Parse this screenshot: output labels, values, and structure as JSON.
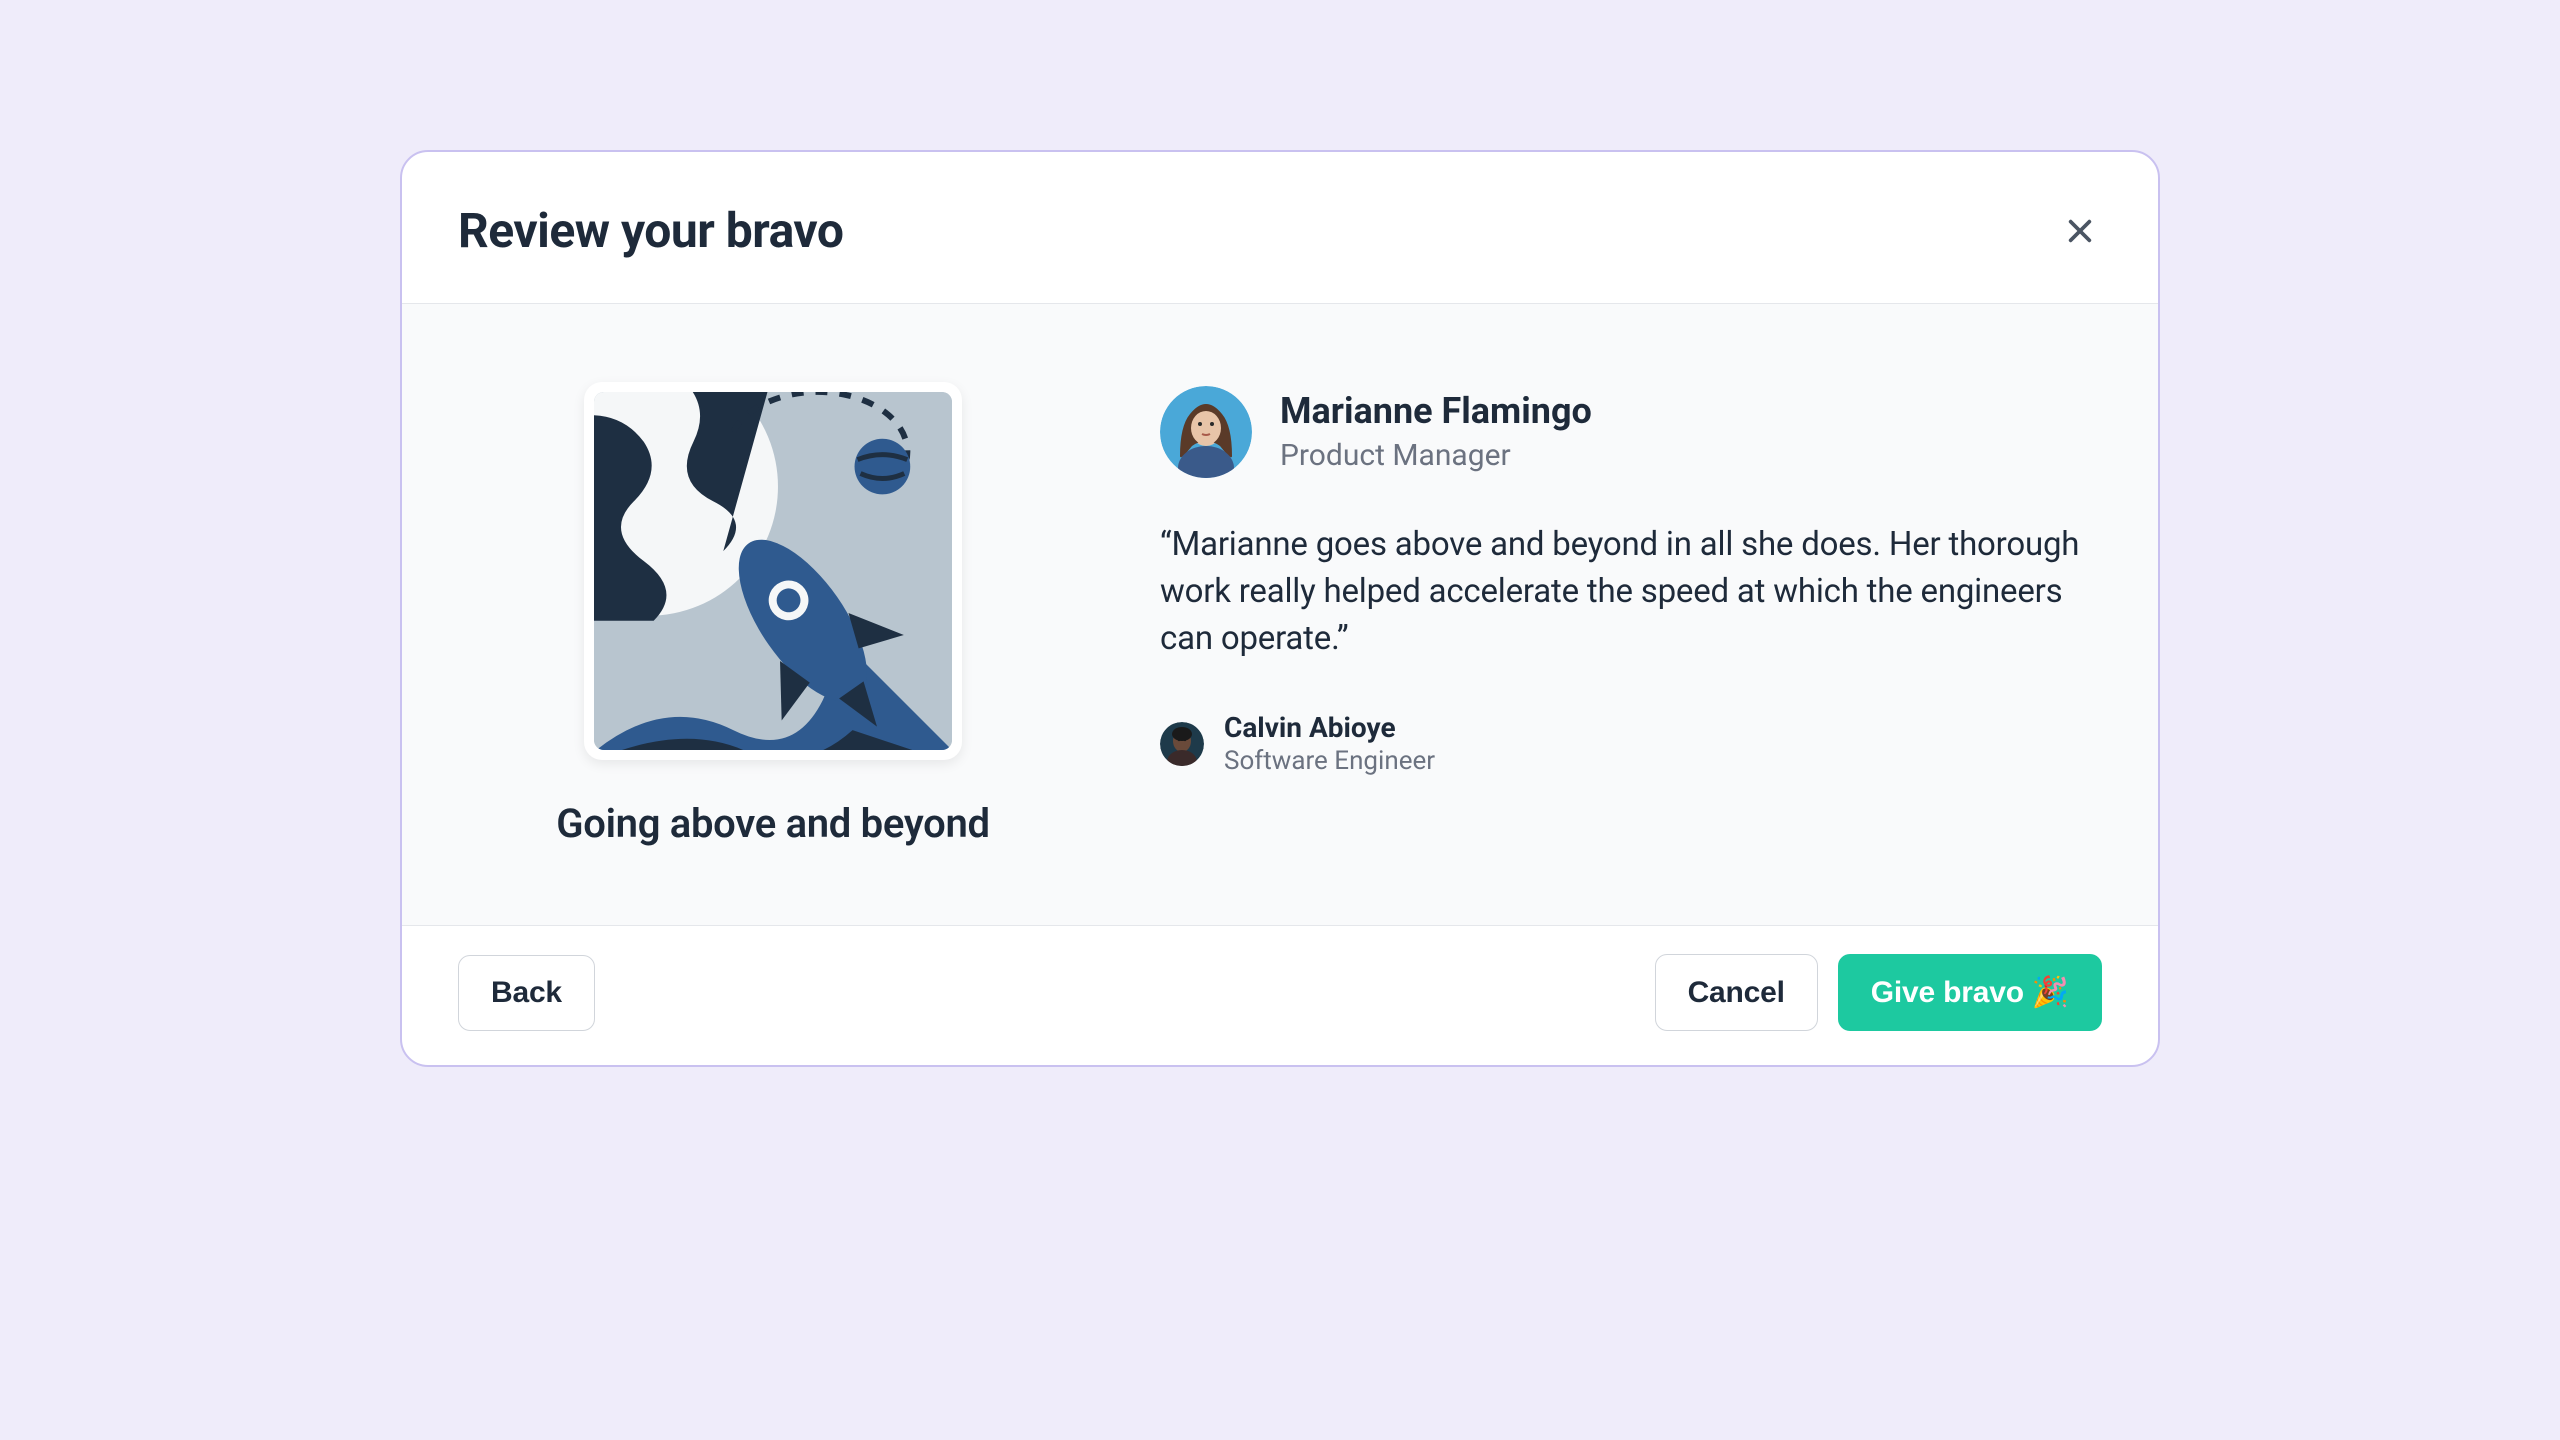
{
  "modal": {
    "title": "Review your bravo"
  },
  "badge": {
    "title": "Going above and beyond"
  },
  "recipient": {
    "name": "Marianne Flamingo",
    "title": "Product Manager"
  },
  "quote": "“Marianne goes above and beyond in all she does. Her thorough work really helped accelerate the speed at which the engineers can operate.”",
  "sender": {
    "name": "Calvin Abioye",
    "title": "Software Engineer"
  },
  "footer": {
    "back": "Back",
    "cancel": "Cancel",
    "give_bravo": "Give bravo"
  },
  "icons": {
    "celebration": "🎉"
  }
}
